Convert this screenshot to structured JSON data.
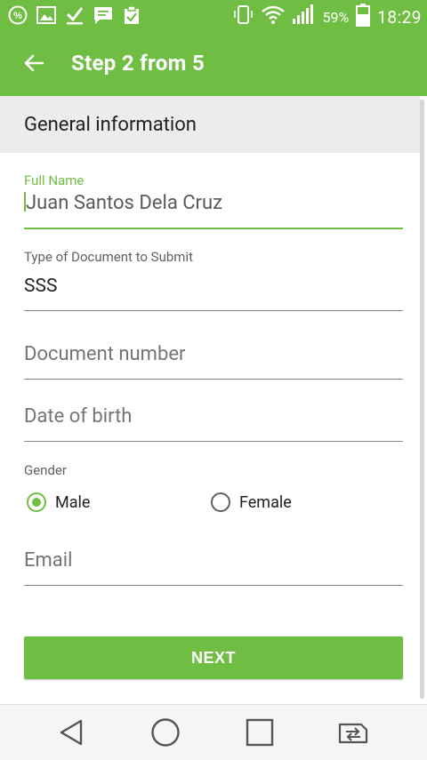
{
  "status_bar": {
    "battery_percent": "59%",
    "time": "18:29",
    "icons": [
      "percent-icon",
      "image-icon",
      "download-check-icon",
      "message-icon",
      "clipboard-icon",
      "phone-vibrate-icon",
      "wifi-icon",
      "signal-icon",
      "battery-icon"
    ]
  },
  "app_bar": {
    "title": "Step 2 from 5",
    "back_icon": "arrow-left-icon"
  },
  "section": {
    "title": "General information"
  },
  "form": {
    "full_name": {
      "label": "Full Name",
      "value": "Juan Santos Dela Cruz"
    },
    "document_type": {
      "label": "Type of Document to Submit",
      "value": "SSS"
    },
    "document_number": {
      "placeholder": "Document number"
    },
    "date_of_birth": {
      "placeholder": "Date of birth"
    },
    "gender": {
      "label": "Gender",
      "options": [
        "Male",
        "Female"
      ],
      "selected": "Male"
    },
    "email": {
      "placeholder": "Email"
    }
  },
  "next_button": {
    "label": "NEXT"
  },
  "nav_bar": {
    "icons": [
      "back-triangle-icon",
      "home-circle-icon",
      "recents-square-icon",
      "switch-sim-icon"
    ]
  },
  "colors": {
    "accent": "#6fbd43",
    "section_bg": "#ececec",
    "nav_bg": "#f5f5f5"
  }
}
